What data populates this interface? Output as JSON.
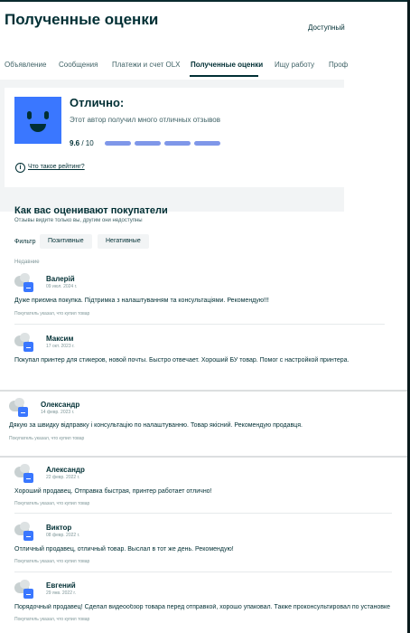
{
  "header": {
    "title": "Полученные оценки",
    "available": "Доступный"
  },
  "tabs": [
    {
      "label": "Объявление"
    },
    {
      "label": "Сообщения"
    },
    {
      "label": "Платежи и счет OLX"
    },
    {
      "label": "Полученные оценки",
      "active": true
    },
    {
      "label": "Ищу работу"
    },
    {
      "label": "Проф"
    }
  ],
  "rating": {
    "title": "Отлично:",
    "description": "Этот автор получил много отличных отзывов",
    "score": "9.6",
    "score_max": "/ 10",
    "segments_filled": 4,
    "segments_total": 4,
    "info_link": "Что такое рейтинг?",
    "face_color": "#3a77ff",
    "bar_color": "#7f97e9"
  },
  "reviews_section": {
    "title": "Как вас оценивают покупатели",
    "subtitle": "Отзывы видите только вы, другим они недоступны",
    "filter_label": "Фильтр",
    "filter_positive": "Позитивные",
    "filter_negative": "Негативные",
    "recent_label": "Недавние",
    "bought_label": "Покупатель указал, что купил товар"
  },
  "reviews": [
    {
      "name": "Валерій",
      "date": "09 июл. 2024 г.",
      "text": "Дуже приємна покупка. Підтримка з налаштуванням та консультаціями. Рекомендую!!!"
    },
    {
      "name": "Максим",
      "date": "17 окт. 2023 г.",
      "text": "Покупал принтер для стикеров, новой почты. Быстро отвечает. Хороший БУ товар. Помог с настройкой принтера."
    },
    {
      "name": "Олександр",
      "date": "14 февр. 2023 г.",
      "text": "Дякую за швидку відправку і консультацію по налаштуванню. Товар якісний. Рекомендую продавця."
    },
    {
      "name": "Александр",
      "date": "22 февр. 2022 г.",
      "text": "Хороший продавец. Отправка быстрая, принтер работает отлично!"
    },
    {
      "name": "Виктор",
      "date": "08 февр. 2022 г.",
      "text": "Отличный продавец, отличный товар. Выслал в тот же день. Рекомендую!"
    },
    {
      "name": "Евгений",
      "date": "29 янв. 2022 г.",
      "text": "Порядочный продавец! Сделал видеообзор товара перед отправкой, хорошо упаковал. Также проконсультировал по установке"
    }
  ]
}
